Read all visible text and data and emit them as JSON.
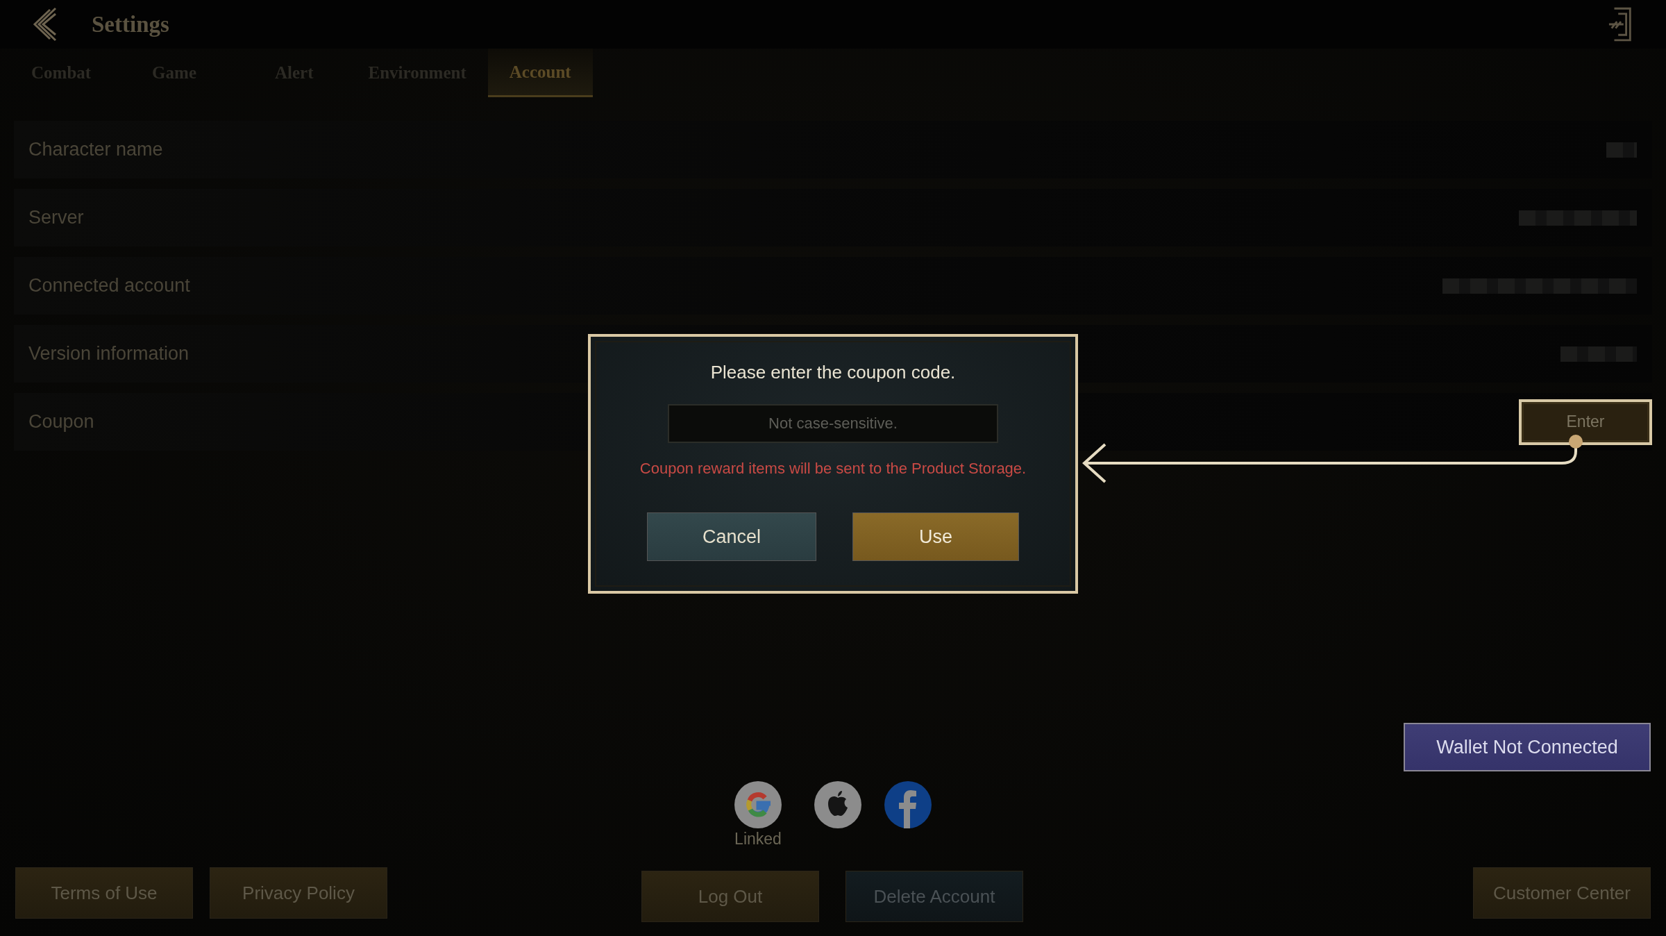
{
  "header": {
    "title": "Settings"
  },
  "tabs": [
    {
      "label": "Combat",
      "selected": false
    },
    {
      "label": "Game",
      "selected": false
    },
    {
      "label": "Alert",
      "selected": false
    },
    {
      "label": "Environment",
      "selected": false
    },
    {
      "label": "Account",
      "selected": true
    }
  ],
  "rows": [
    {
      "label": "Character name",
      "kind": "redacted"
    },
    {
      "label": "Server",
      "kind": "redacted"
    },
    {
      "label": "Connected account",
      "kind": "redacted"
    },
    {
      "label": "Version information",
      "kind": "redacted"
    },
    {
      "label": "Coupon",
      "kind": "button",
      "button": "Enter"
    }
  ],
  "wallet_button": "Wallet Not Connected",
  "social": [
    {
      "kind": "google",
      "caption": "Linked"
    },
    {
      "kind": "apple"
    },
    {
      "kind": "facebook"
    }
  ],
  "footer_buttons": [
    {
      "label": "Terms of Use",
      "kind": "gold"
    },
    {
      "label": "Privacy Policy",
      "kind": "gold"
    },
    {
      "label": "Log Out",
      "kind": "gold"
    },
    {
      "label": "Delete Account",
      "kind": "teal"
    },
    {
      "label": "Customer Center",
      "kind": "gold"
    }
  ],
  "dialog": {
    "title": "Please enter the coupon code.",
    "placeholder": "Not case-sensitive.",
    "notice": "Coupon reward items will be sent to the Product Storage.",
    "buttons": [
      {
        "label": "Cancel",
        "kind": "teal"
      },
      {
        "label": "Use",
        "kind": "gold"
      }
    ]
  }
}
